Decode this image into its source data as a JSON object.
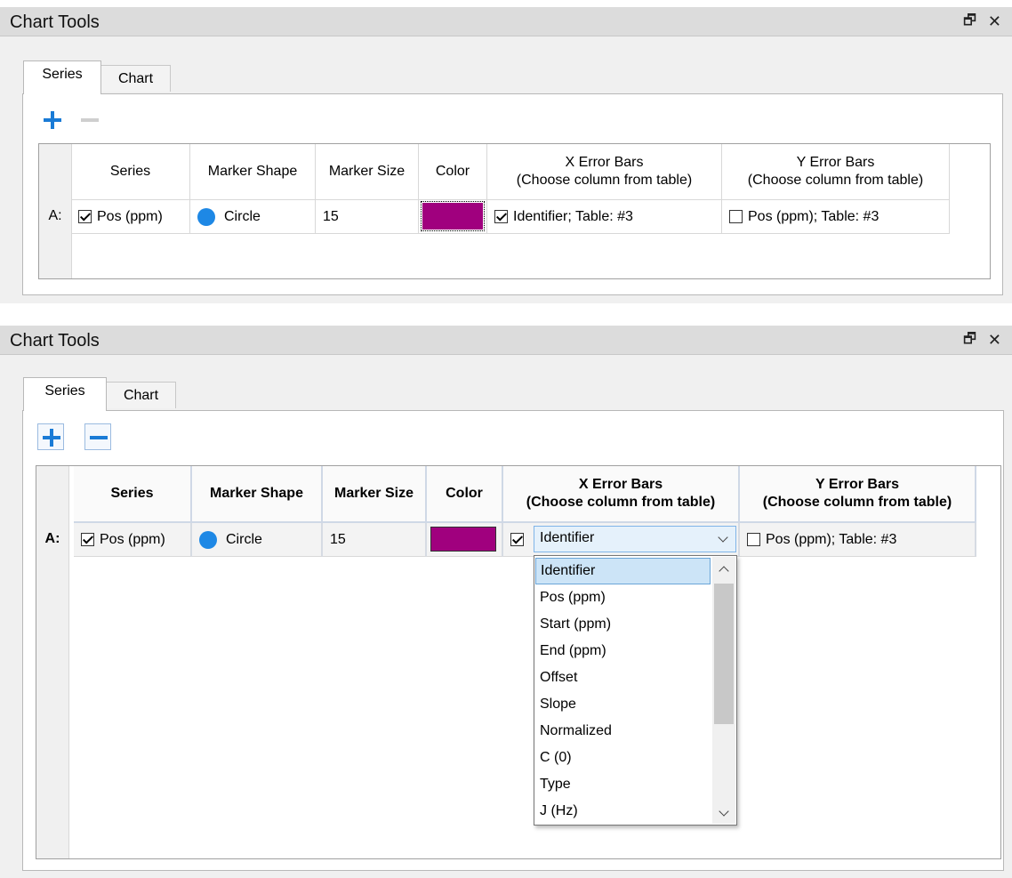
{
  "window_title": "Chart Tools",
  "window_buttons": {
    "restore": "🗗",
    "close": "✕"
  },
  "tabs": [
    "Series",
    "Chart"
  ],
  "toolbar_icons": {
    "add": "plus-icon",
    "remove": "minus-icon"
  },
  "columns": {
    "series": "Series",
    "marker_shape": "Marker Shape",
    "marker_size": "Marker Size",
    "color": "Color",
    "x_error_line1": "X Error Bars",
    "x_error_line2": "(Choose column from table)",
    "y_error_line1": "Y Error Bars",
    "y_error_line2": "(Choose column from table)"
  },
  "row": {
    "label": "A:",
    "series_name": "Pos (ppm)",
    "series_checked": true,
    "marker_shape": "Circle",
    "marker_color": "#1e88e5",
    "marker_size": "15",
    "color": "#a0007e",
    "x_error_value": "Identifier; Table: #3",
    "x_error_checked": true,
    "y_error_value": "Pos (ppm); Table: #3",
    "y_error_checked": false
  },
  "dropdown": {
    "selected": "Identifier",
    "options": [
      "Identifier",
      "Pos (ppm)",
      "Start (ppm)",
      "End (ppm)",
      "Offset",
      "Slope",
      "Normalized",
      "C (0)",
      "Type",
      "J (Hz)"
    ]
  }
}
